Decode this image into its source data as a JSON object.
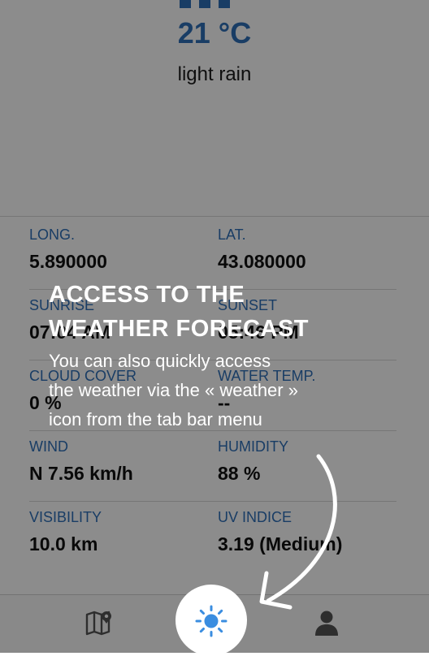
{
  "weather": {
    "temperature": "21 °C",
    "condition": "light rain"
  },
  "details": [
    [
      {
        "label": "LONG.",
        "value": "5.890000"
      },
      {
        "label": "LAT.",
        "value": "43.080000"
      }
    ],
    [
      {
        "label": "SUNRISE",
        "value": "07:04 AM"
      },
      {
        "label": "SUNSET",
        "value": "05:46 PM"
      }
    ],
    [
      {
        "label": "CLOUD COVER",
        "value": "0 %"
      },
      {
        "label": "WATER TEMP.",
        "value": "--"
      }
    ],
    [
      {
        "label": "WIND",
        "value": "N 7.56 km/h"
      },
      {
        "label": "HUMIDITY",
        "value": "88 %"
      }
    ],
    [
      {
        "label": "VISIBILITY",
        "value": "10.0 km"
      },
      {
        "label": "UV INDICE",
        "value": "3.19 (Medium)"
      }
    ]
  ],
  "tabbar": {
    "items": [
      {
        "icon": "map-pin-icon"
      },
      {
        "icon": "sun-icon"
      },
      {
        "icon": "user-icon"
      }
    ]
  },
  "tutorial": {
    "title_line1": "ACCESS TO THE",
    "title_line2": "WEATHER FORECAST",
    "text_line1": "You can also quickly access",
    "text_line2": "the weather via the « weather »",
    "text_line3": "icon from the tab bar menu"
  },
  "colors": {
    "accent": "#2f6fb8",
    "overlay": "rgba(0,0,0,0.45)"
  }
}
